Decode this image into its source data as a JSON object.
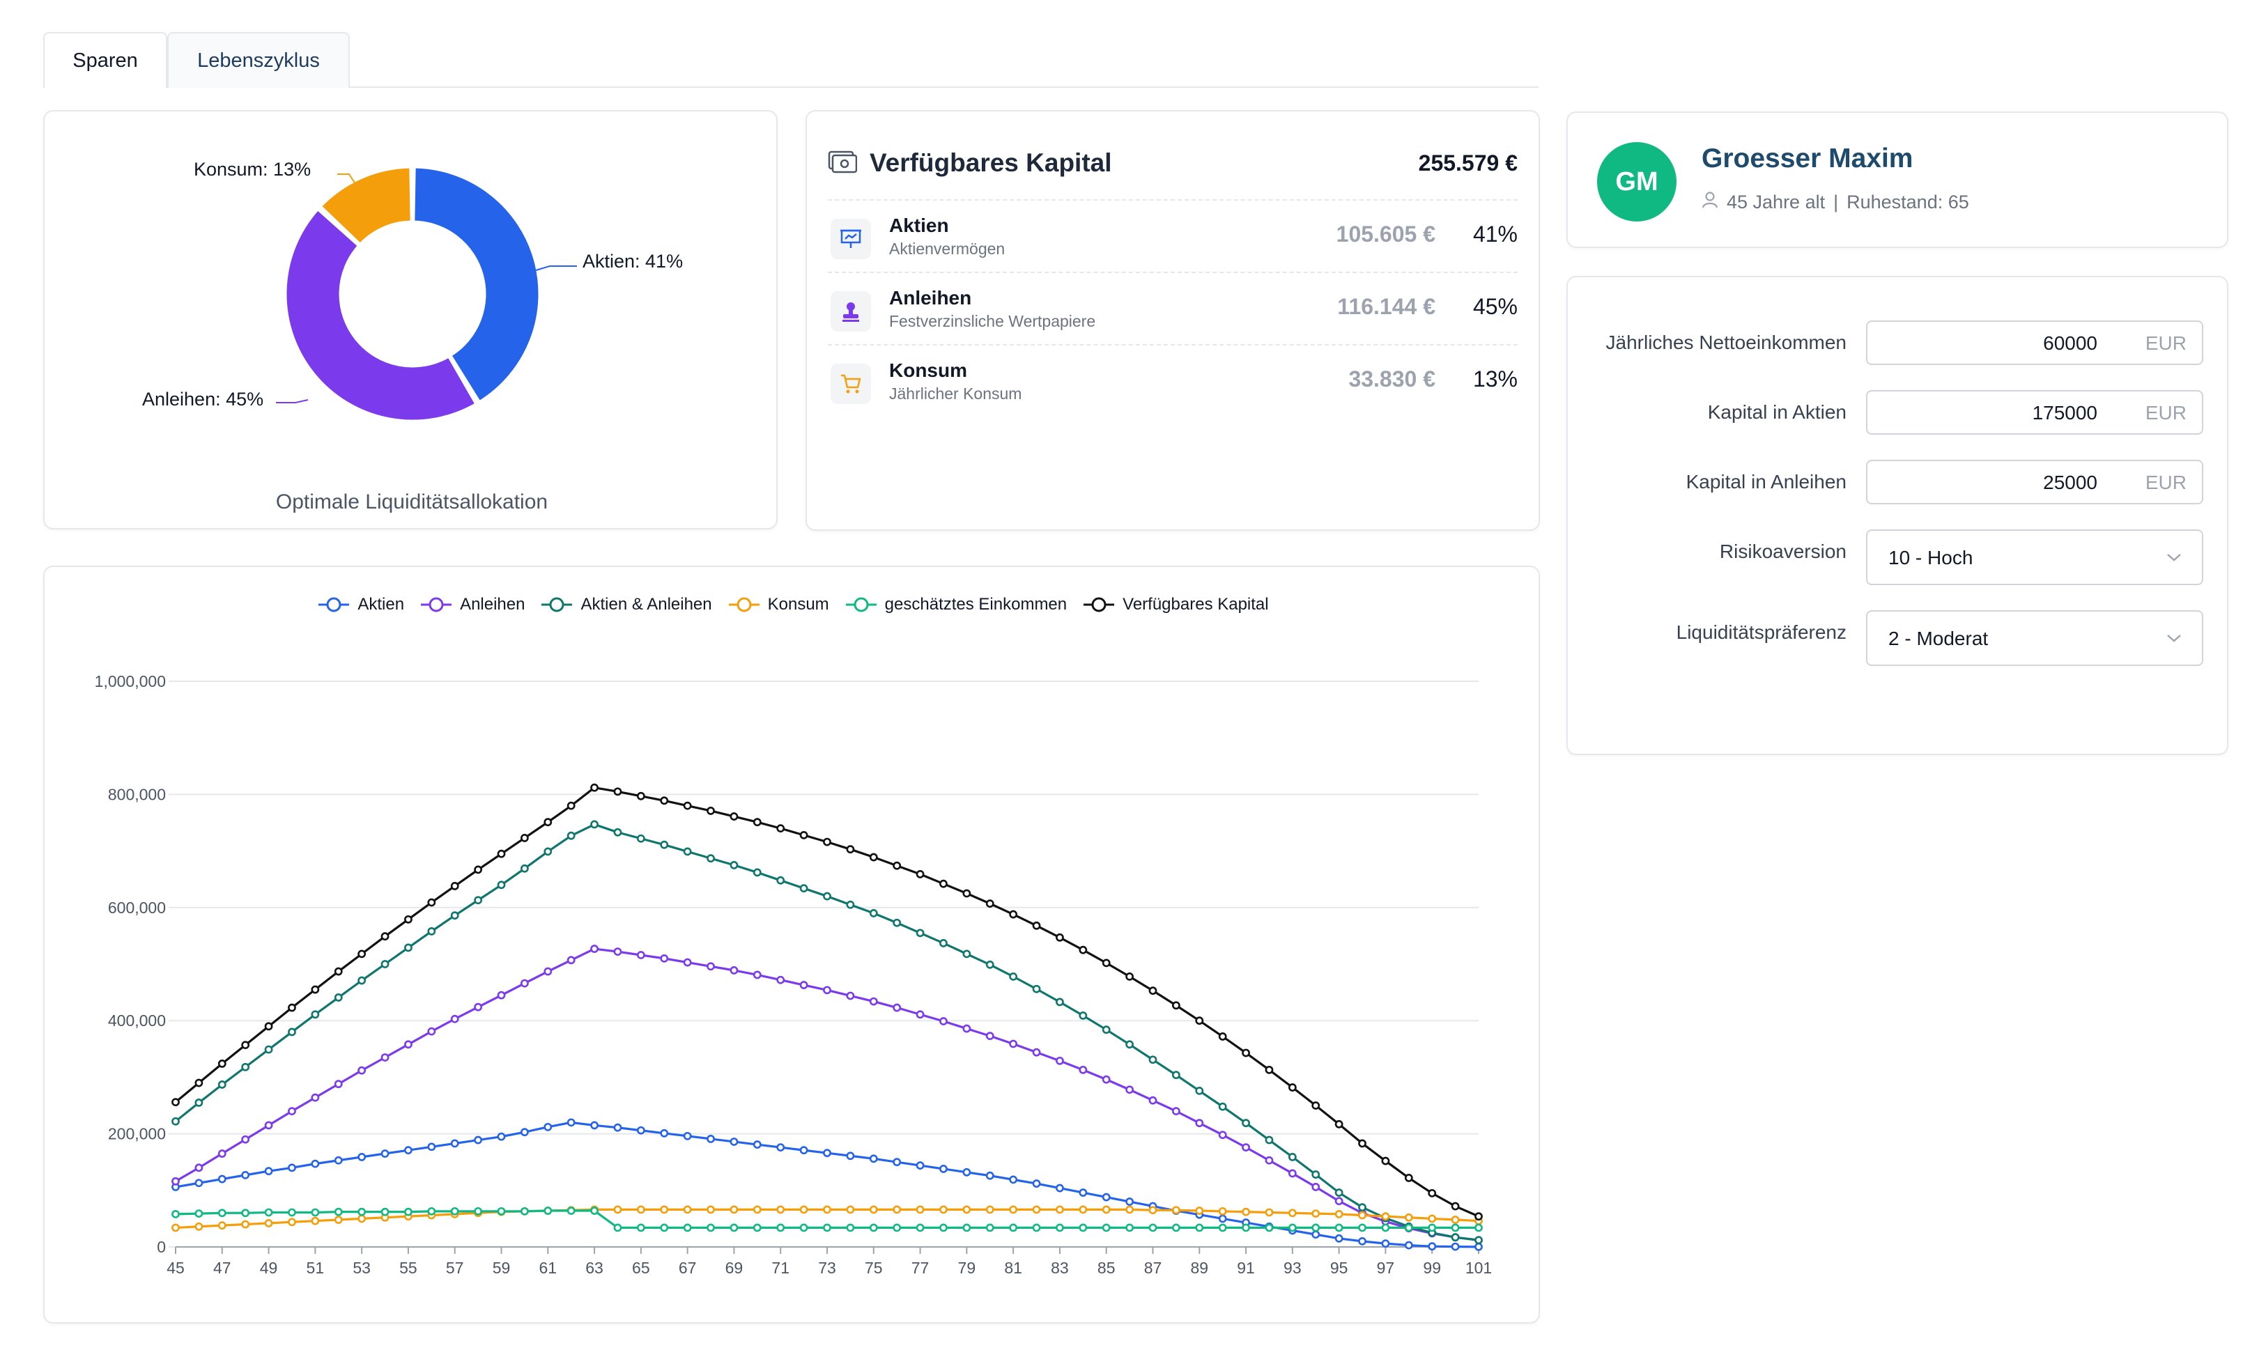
{
  "tabs": [
    {
      "label": "Sparen",
      "active": false
    },
    {
      "label": "Lebenszyklus",
      "active": true
    }
  ],
  "allocation": {
    "caption": "Optimale Liquiditätsallokation",
    "slices": [
      {
        "name": "Aktien",
        "label": "Aktien: 41%",
        "value": 41,
        "color": "#2563eb"
      },
      {
        "name": "Anleihen",
        "label": "Anleihen: 45%",
        "value": 45,
        "color": "#7c3aed"
      },
      {
        "name": "Konsum",
        "label": "Konsum: 13%",
        "value": 13,
        "color": "#f59e0b"
      }
    ]
  },
  "capital": {
    "title": "Verfügbares Kapital",
    "total": "255.579 €",
    "rows": [
      {
        "name": "Aktien",
        "sub": "Aktienvermögen",
        "amount": "105.605 €",
        "pct": "41%",
        "icon": "presentation-chart-icon",
        "color": "#2563eb"
      },
      {
        "name": "Anleihen",
        "sub": "Festverzinsliche Wertpapiere",
        "amount": "116.144 €",
        "pct": "45%",
        "icon": "stamp-icon",
        "color": "#7c3aed"
      },
      {
        "name": "Konsum",
        "sub": "Jährlicher Konsum",
        "amount": "33.830 €",
        "pct": "13%",
        "icon": "shopping-cart-icon",
        "color": "#f59e0b"
      }
    ]
  },
  "profile": {
    "initials": "GM",
    "name": "Groesser Maxim",
    "age": "45 Jahre alt",
    "separator": "|",
    "retirement": "Ruhestand: 65"
  },
  "form": {
    "income": {
      "label": "Jährliches Nettoeinkommen",
      "value": "60000",
      "unit": "EUR"
    },
    "stocks": {
      "label": "Kapital in Aktien",
      "value": "175000",
      "unit": "EUR"
    },
    "bonds": {
      "label": "Kapital in Anleihen",
      "value": "25000",
      "unit": "EUR"
    },
    "risk": {
      "label": "Risikoaversion",
      "value": "10 - Hoch"
    },
    "liquidity": {
      "label": "Liquiditätspräferenz",
      "value": "2 - Moderat"
    }
  },
  "colors": {
    "aktien": "#2563eb",
    "anleihen": "#7c3aed",
    "beide": "#0f766e",
    "konsum": "#f59e0b",
    "einkommen": "#10b981",
    "kapital": "#111111"
  },
  "chart_data": {
    "type": "line",
    "xlabel": "",
    "ylabel": "",
    "ylim": [
      0,
      1000000
    ],
    "yticks": [
      "0",
      "200,000",
      "400,000",
      "600,000",
      "800,000",
      "1,000,000"
    ],
    "xticks": [
      "45",
      "47",
      "49",
      "51",
      "53",
      "55",
      "57",
      "59",
      "61",
      "63",
      "65",
      "67",
      "69",
      "71",
      "73",
      "75",
      "77",
      "79",
      "81",
      "83",
      "85",
      "87",
      "89",
      "91",
      "93",
      "95",
      "97",
      "99",
      "101"
    ],
    "x_start": 45,
    "x_end": 101,
    "legend": "top-center",
    "grid": true,
    "series": [
      {
        "name": "Aktien",
        "color": "#2563eb",
        "values": [
          106000,
          113000,
          120000,
          127000,
          134000,
          140000,
          147000,
          153000,
          159000,
          165000,
          171000,
          177000,
          183000,
          189000,
          195000,
          203000,
          212000,
          220000,
          215000,
          211000,
          206000,
          201000,
          196000,
          191000,
          186000,
          181000,
          176000,
          171000,
          166000,
          161000,
          156000,
          150000,
          144000,
          138000,
          132000,
          126000,
          119000,
          112000,
          104000,
          96000,
          88000,
          80000,
          72000,
          64000,
          57000,
          50000,
          43000,
          36000,
          29000,
          22000,
          15000,
          10000,
          6000,
          3000,
          1000,
          500,
          200
        ]
      },
      {
        "name": "Anleihen",
        "color": "#7c3aed",
        "values": [
          116000,
          140000,
          165000,
          190000,
          215000,
          240000,
          264000,
          288000,
          312000,
          335000,
          358000,
          381000,
          403000,
          424000,
          445000,
          466000,
          487000,
          507000,
          527000,
          522000,
          516000,
          510000,
          503000,
          496000,
          489000,
          481000,
          472000,
          463000,
          454000,
          444000,
          434000,
          423000,
          411000,
          399000,
          386000,
          373000,
          359000,
          344000,
          329000,
          313000,
          296000,
          278000,
          259000,
          240000,
          219000,
          198000,
          176000,
          153000,
          130000,
          106000,
          81000,
          60000,
          45000,
          33000,
          24000,
          17000,
          12000
        ]
      },
      {
        "name": "Aktien & Anleihen",
        "color": "#0f766e",
        "values": [
          222000,
          255000,
          287000,
          318000,
          349000,
          380000,
          411000,
          441000,
          471000,
          500000,
          529000,
          558000,
          586000,
          613000,
          640000,
          669000,
          699000,
          727000,
          747000,
          733000,
          722000,
          711000,
          699000,
          687000,
          675000,
          662000,
          648000,
          634000,
          620000,
          605000,
          590000,
          573000,
          555000,
          537000,
          518000,
          499000,
          478000,
          456000,
          433000,
          409000,
          384000,
          358000,
          331000,
          304000,
          276000,
          248000,
          219000,
          189000,
          159000,
          128000,
          96000,
          70000,
          51000,
          36000,
          25000,
          17000,
          12000
        ]
      },
      {
        "name": "Konsum",
        "color": "#f59e0b",
        "values": [
          34000,
          36000,
          38000,
          40000,
          42000,
          44000,
          46000,
          48000,
          50000,
          52000,
          54000,
          56000,
          58000,
          60000,
          62000,
          63000,
          64000,
          65000,
          66000,
          66000,
          66000,
          66000,
          66000,
          66000,
          66000,
          66000,
          66000,
          66000,
          66000,
          66000,
          66000,
          66000,
          66000,
          66000,
          66000,
          66000,
          66000,
          66000,
          66000,
          66000,
          66000,
          66000,
          65000,
          65000,
          64000,
          63000,
          62000,
          61000,
          60000,
          59000,
          58000,
          56000,
          54000,
          52000,
          50000,
          48000,
          46000
        ]
      },
      {
        "name": "geschätztes Einkommen",
        "color": "#10b981",
        "values": [
          58000,
          59000,
          60000,
          60000,
          61000,
          61000,
          61000,
          62000,
          62000,
          62000,
          62000,
          63000,
          63000,
          63000,
          63000,
          63000,
          64000,
          64000,
          64000,
          34000,
          34000,
          34000,
          34000,
          34000,
          34000,
          34000,
          34000,
          34000,
          34000,
          34000,
          34000,
          34000,
          34000,
          34000,
          34000,
          34000,
          34000,
          34000,
          34000,
          34000,
          34000,
          34000,
          34000,
          34000,
          34000,
          34000,
          34000,
          34000,
          34000,
          34000,
          34000,
          34000,
          34000,
          34000,
          34000,
          34000,
          34000
        ]
      },
      {
        "name": "Verfügbares Kapital",
        "color": "#111111",
        "values": [
          256000,
          290000,
          324000,
          357000,
          390000,
          423000,
          455000,
          487000,
          518000,
          549000,
          579000,
          609000,
          638000,
          667000,
          695000,
          723000,
          751000,
          780000,
          812000,
          805000,
          797000,
          789000,
          780000,
          771000,
          761000,
          751000,
          740000,
          728000,
          716000,
          703000,
          689000,
          674000,
          659000,
          642000,
          625000,
          607000,
          588000,
          568000,
          547000,
          525000,
          502000,
          478000,
          453000,
          427000,
          400000,
          372000,
          343000,
          313000,
          282000,
          250000,
          217000,
          183000,
          152000,
          122000,
          95000,
          72000,
          54000
        ]
      }
    ]
  }
}
